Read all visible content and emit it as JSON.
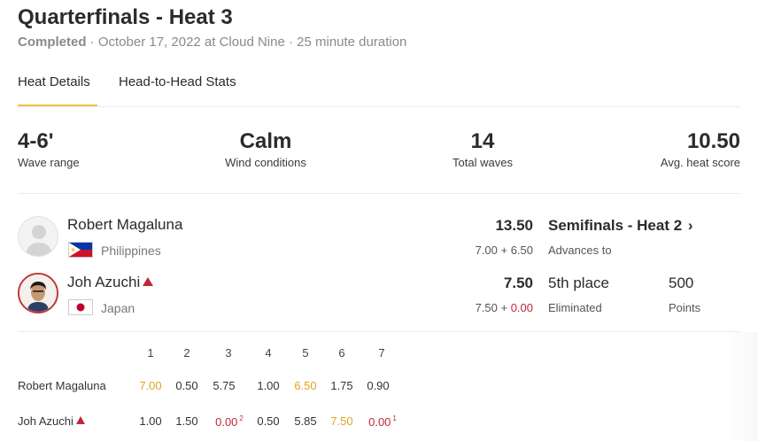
{
  "header": {
    "title": "Quarterfinals - Heat 3",
    "status": "Completed",
    "details": " · October 17, 2022 at Cloud Nine · 25 minute duration"
  },
  "tabs": [
    {
      "label": "Heat Details",
      "active": true
    },
    {
      "label": "Head-to-Head Stats",
      "active": false
    }
  ],
  "stats": [
    {
      "value": "4-6'",
      "label": "Wave range"
    },
    {
      "value": "Calm",
      "label": "Wind conditions"
    },
    {
      "value": "14",
      "label": "Total waves"
    },
    {
      "value": "10.50",
      "label": "Avg. heat score"
    }
  ],
  "surfers": [
    {
      "name": "Robert Magaluna",
      "country": "Philippines",
      "flag_icon": "philippines-flag-icon",
      "total": "13.50",
      "sum_a": "7.00 + 6.50",
      "result": "Semifinals - Heat 2",
      "result_sub": "Advances to",
      "chevron": "›"
    },
    {
      "name": "Joh Azuchi",
      "country": "Japan",
      "flag_icon": "japan-flag-icon",
      "total": "7.50",
      "sum_a": "7.50 + ",
      "sum_b": "0.00",
      "result": "5th place",
      "result_sub": "Eliminated",
      "points": "500",
      "points_label": "Points"
    }
  ],
  "waves": {
    "headers": [
      "1",
      "2",
      "3",
      "4",
      "5",
      "6",
      "7"
    ],
    "rows": [
      {
        "name": "Robert Magaluna",
        "scores": [
          "7.00",
          "0.50",
          "5.75",
          "1.00",
          "6.50",
          "1.75",
          "0.90"
        ],
        "notes": [
          "",
          "",
          "",
          "",
          "",
          "",
          ""
        ]
      },
      {
        "name": "Joh Azuchi",
        "scores": [
          "1.00",
          "1.50",
          "0.00",
          "0.50",
          "5.85",
          "7.50",
          "0.00"
        ],
        "notes": [
          "",
          "",
          "2",
          "",
          "",
          "",
          "1"
        ]
      }
    ]
  },
  "colors": {
    "highlight": "#e3a320",
    "penalty": "#c0273a",
    "tab_underline": "#f2c14a"
  }
}
